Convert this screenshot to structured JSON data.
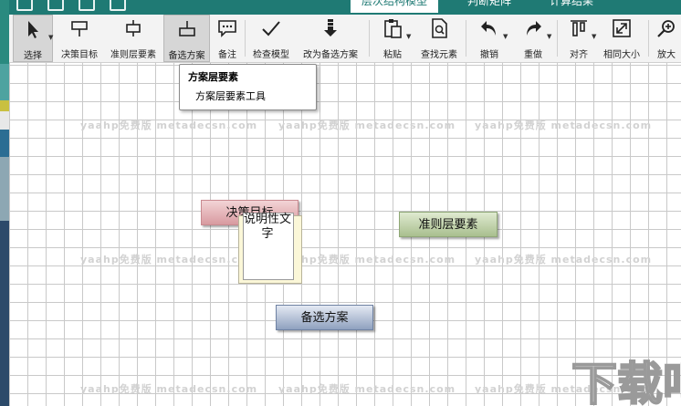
{
  "titlebar": {
    "tabs": [
      {
        "label": "层次结构模型",
        "active": true
      },
      {
        "label": "判断矩阵",
        "active": false
      },
      {
        "label": "计算结果",
        "active": false
      }
    ]
  },
  "ribbon": {
    "buttons": [
      {
        "name": "select-button",
        "icon": "cursor-icon",
        "label": "选择",
        "selected": true
      },
      {
        "name": "goal-button",
        "icon": "goal-node-icon",
        "label": "决策目标"
      },
      {
        "name": "criteria-button",
        "icon": "criteria-node-icon",
        "label": "准则层要素"
      },
      {
        "name": "alternative-button",
        "icon": "alternative-node-icon",
        "label": "备选方案",
        "selected": true
      },
      {
        "name": "note-button",
        "icon": "comment-icon",
        "label": "备注"
      },
      {
        "name": "check-model-button",
        "icon": "checkmark-icon",
        "label": "检查模型"
      },
      {
        "name": "change-to-alternative-button",
        "icon": "arrow-down-icon",
        "label": "改为备选方案"
      },
      {
        "name": "paste-button",
        "icon": "clipboard-icon",
        "label": "粘贴"
      },
      {
        "name": "find-element-button",
        "icon": "search-document-icon",
        "label": "查找元素"
      },
      {
        "name": "undo-button",
        "icon": "undo-icon",
        "label": "撤销"
      },
      {
        "name": "redo-button",
        "icon": "redo-icon",
        "label": "重做"
      },
      {
        "name": "align-button",
        "icon": "align-top-icon",
        "label": "对齐"
      },
      {
        "name": "same-size-button",
        "icon": "resize-icon",
        "label": "相同大小"
      },
      {
        "name": "zoom-in-button",
        "icon": "zoom-in-icon",
        "label": "放大"
      }
    ]
  },
  "tooltip": {
    "title": "方案层要素",
    "desc": "方案层要素工具"
  },
  "canvas": {
    "nodes": {
      "goal": "决策目标",
      "criteria": "准则层要素",
      "alternative": "备选方案"
    },
    "note_text": "说明性文字",
    "watermark": "yaahp免费版 metadecsn.com"
  },
  "colors": {
    "titlebar": "#1f7a74",
    "goal_node": "#d89aa0",
    "criteria_node": "#a9bf8e",
    "alternative_node": "#8fa1bf"
  },
  "logo": {
    "text": "下载吧"
  }
}
